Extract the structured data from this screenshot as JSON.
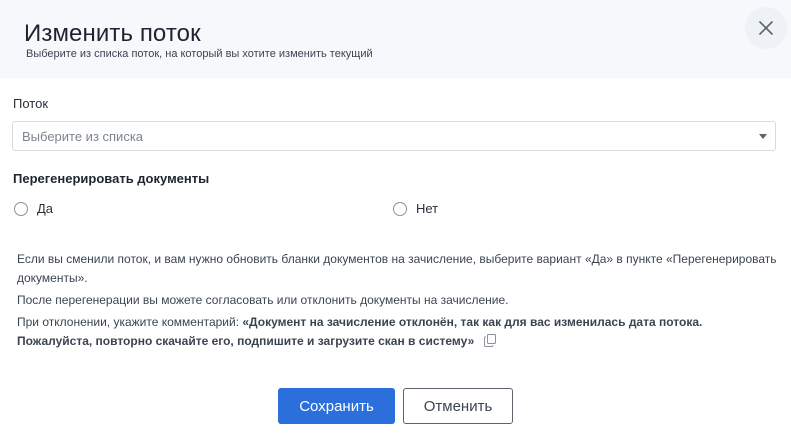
{
  "dialog": {
    "title": "Изменить поток",
    "subtitle": "Выберите из списка поток, на который вы хотите изменить текущий",
    "close_icon": "close-icon"
  },
  "stream_field": {
    "label": "Поток",
    "placeholder": "Выберите из списка",
    "selected_value": ""
  },
  "regenerate": {
    "label": "Перегенерировать документы",
    "options": [
      {
        "label": "Да",
        "checked": false
      },
      {
        "label": "Нет",
        "checked": false
      }
    ]
  },
  "info": {
    "paragraph1": "Если вы сменили поток, и вам нужно обновить бланки документов на зачисление, выберите вариант «Да» в пункте «Перегенерировать документы».",
    "paragraph2": "После перегенерации вы можете согласовать или отклонить документы на зачисление.",
    "paragraph3_prefix": "При отклонении, укажите комментарий: ",
    "paragraph3_quote": "«Документ на зачисление отклонён, так как для вас изменилась дата потока. Пожалуйста, повторно скачайте его, подпишите и загрузите скан в систему»",
    "copy_icon": "copy-icon"
  },
  "buttons": {
    "save": "Сохранить",
    "cancel": "Отменить"
  },
  "colors": {
    "primary": "#2a6fdb",
    "header_bg": "#f6f8fb",
    "text": "#1f2933"
  }
}
